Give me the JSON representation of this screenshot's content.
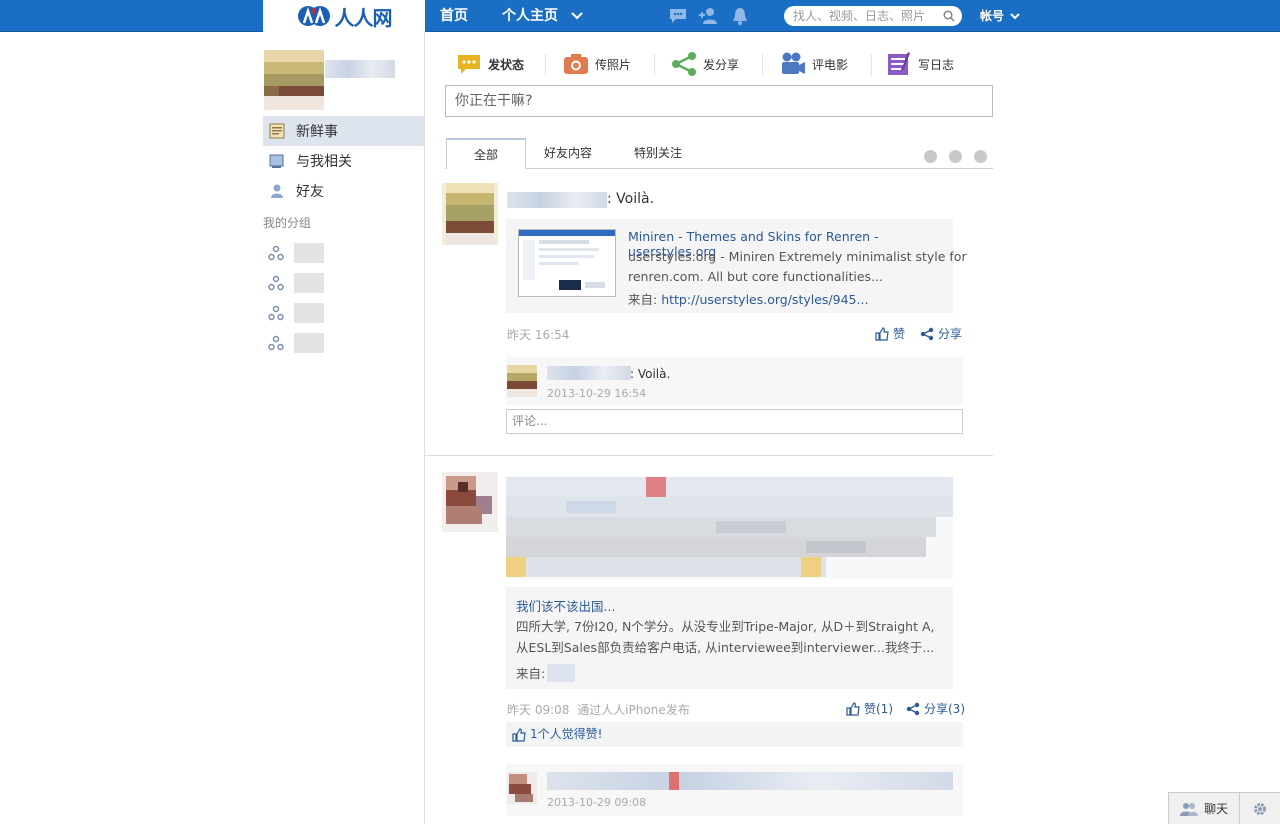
{
  "header": {
    "logo_text": "人人网",
    "nav": {
      "home": "首页",
      "profile": "个人主页"
    },
    "search_placeholder": "找人、视频、日志、照片",
    "account": "帐号"
  },
  "sidebar": {
    "items": [
      {
        "label": "新鲜事",
        "icon": "news-icon",
        "active": true
      },
      {
        "label": "与我相关",
        "icon": "related-icon",
        "active": false
      },
      {
        "label": "好友",
        "icon": "friends-icon",
        "active": false
      }
    ],
    "group_label": "我的分组"
  },
  "publisher": {
    "tabs": [
      {
        "label": "发状态",
        "icon": "status-bubble-icon",
        "active": true
      },
      {
        "label": "传照片",
        "icon": "camera-icon",
        "active": false
      },
      {
        "label": "发分享",
        "icon": "share-icon",
        "active": false
      },
      {
        "label": "评电影",
        "icon": "movie-camera-icon",
        "active": false
      },
      {
        "label": "写日志",
        "icon": "notebook-icon",
        "active": false
      }
    ],
    "input_placeholder": "你正在干嘛?"
  },
  "feed_tabs": [
    "全部",
    "好友内容",
    "特别关注"
  ],
  "feed": [
    {
      "text": ": Voilà.",
      "card": {
        "title": "Miniren - Themes and Skins for Renren - userstyles.org",
        "line1": "userstyles.org - Miniren Extremely minimalist style for",
        "line2": "renren.com. All but core functionalities...",
        "source_label": "来自:",
        "source_link": "http://userstyles.org/styles/945..."
      },
      "time": "昨天 16:54",
      "like": "赞",
      "share": "分享",
      "comment": {
        "text": ": Voilà.",
        "time": "2013-10-29 16:54"
      },
      "comment_placeholder": "评论..."
    },
    {
      "card": {
        "title": "我们该不该出国...",
        "line1": "四所大学, 7份I20, N个学分。从没专业到Tripe-Major, 从D＋到Straight A,",
        "line2": "从ESL到Sales部负责给客户电话, 从interviewee到interviewer...我终于...",
        "source_label": "来自:"
      },
      "time": "昨天 09:08",
      "via": "通过人人iPhone发布",
      "like": "赞(1)",
      "share": "分享(3)",
      "likes_text": "1个人觉得赞!",
      "comment": {
        "time": "2013-10-29 09:08"
      }
    }
  ],
  "chat": {
    "label": "聊天"
  },
  "colors": {
    "brand_blue": "#1a6fc4",
    "link_blue": "#2b5a97"
  }
}
